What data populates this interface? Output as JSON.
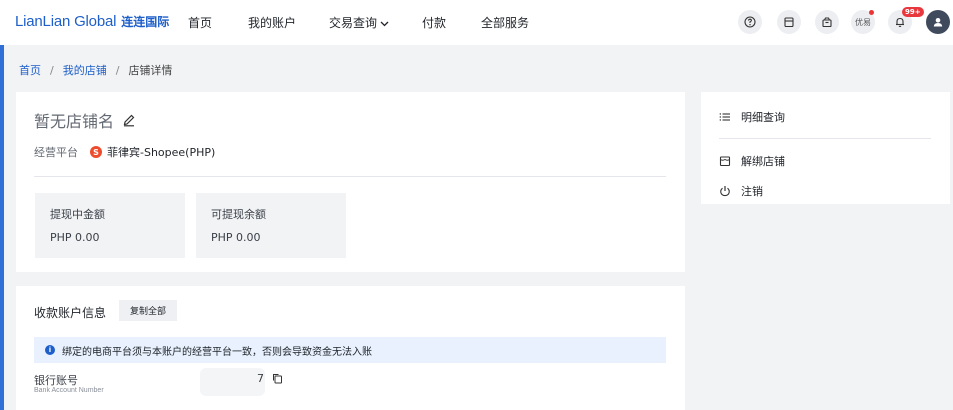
{
  "header": {
    "logo_en": "LianLian Global",
    "logo_cn": "连连国际",
    "nav": [
      "首页",
      "我的账户",
      "交易查询",
      "付款",
      "全部服务"
    ],
    "you_label": "优易",
    "bell_badge": "99+"
  },
  "breadcrumb": [
    "首页",
    "我的店铺",
    "店铺详情"
  ],
  "shop": {
    "name": "暂无店铺名",
    "platform_label": "经营平台",
    "platform_icon_text": "S",
    "platform_value": "菲律宾-Shopee(PHP)",
    "stats": [
      {
        "label": "提现中金额",
        "value": "PHP 0.00"
      },
      {
        "label": "可提现余额",
        "value": "PHP 0.00"
      }
    ]
  },
  "side": {
    "items": [
      "明细查询",
      "解绑店铺",
      "注销"
    ]
  },
  "account": {
    "title": "收款账户信息",
    "copy_all": "复制全部",
    "notice": "绑定的电商平台须与本账户的经营平台一致，否则会导致资金无法入账",
    "bank_label": "银行账号",
    "bank_sub": "Bank Account Number",
    "bank_value_tail": "7"
  },
  "colors": {
    "brand": "#1e5fc9",
    "shopee": "#ee4d2d",
    "badge": "#e8383d"
  }
}
